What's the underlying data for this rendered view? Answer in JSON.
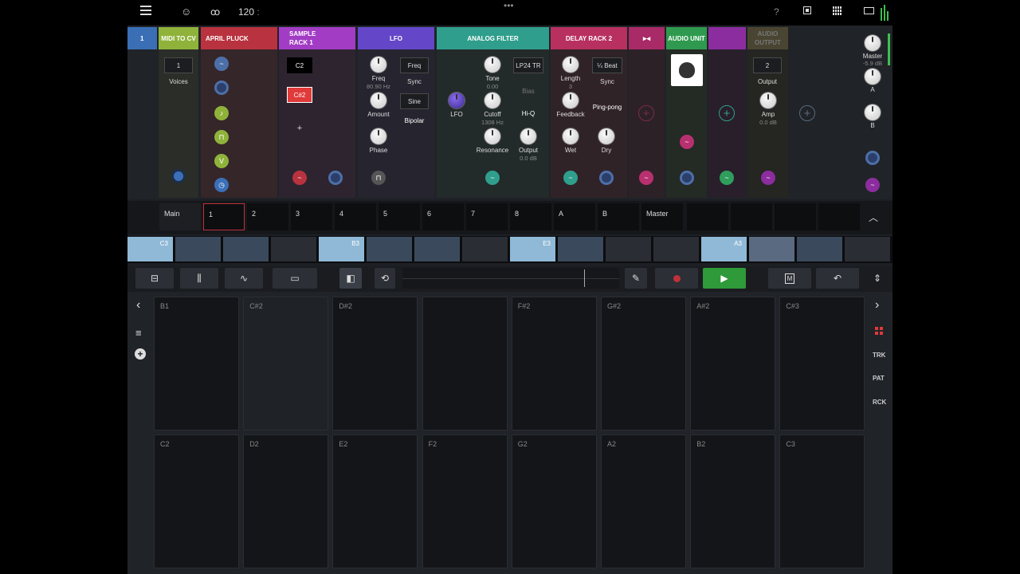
{
  "topbar": {
    "tempo": "120",
    "tempo_sep": ":"
  },
  "modules": {
    "track": {
      "label": "1",
      "color": "#3a6fb5"
    },
    "midi": {
      "title": "MIDI TO CV",
      "color": "#8fb33a",
      "value": "1",
      "value_label": "Voices"
    },
    "pluck": {
      "title": "APRIL PLUCK",
      "color": "#b8333f"
    },
    "sample": {
      "title_line1": "SAMPLE",
      "title_line2": "RACK 1",
      "color": "#a23cc4",
      "slot1": "C2",
      "slot2": "C#2",
      "add": "+"
    },
    "lfo": {
      "title": "LFO",
      "color": "#6447c8",
      "freq_label": "Freq",
      "freq_value": "80.90 Hz",
      "amount_label": "Amount",
      "phase_label": "Phase",
      "freq_box": "Freq",
      "sync_label": "Sync",
      "shape_box": "Sine",
      "bipolar_label": "Bipolar"
    },
    "filter": {
      "title": "ANALOG FILTER",
      "color": "#2f9e8c",
      "lfo_label": "LFO",
      "tone_label": "Tone",
      "tone_value": "0.00",
      "cutoff_label": "Cutoff",
      "cutoff_value": "1308 Hz",
      "resonance_label": "Resonance",
      "mode_box": "LP24 TR",
      "bias_label": "Bias",
      "hiq_label": "Hi-Q",
      "output_label": "Output",
      "output_value": "0.0 dB"
    },
    "delay": {
      "title": "DELAY RACK 2",
      "color": "#b83060",
      "length_label": "Length",
      "length_value": "3",
      "beat_box": "¼ Beat",
      "sync_label": "Sync",
      "feedback_label": "Feedback",
      "pingpong_label": "Ping-pong",
      "wet_label": "Wet",
      "dry_label": "Dry"
    },
    "arrow": {
      "title": "▸◂",
      "color": "#a82a66"
    },
    "audio_unit": {
      "title": "AUDIO UNIT",
      "color": "#2f9a4f"
    },
    "purple": {
      "color": "#8b2d9e"
    },
    "audio_out": {
      "title_line1": "AUDIO",
      "title_line2": "OUTPUT",
      "color": "#4a4532",
      "value": "2",
      "value_label": "Output",
      "amp_label": "Amp",
      "amp_value": "0.0 dB"
    },
    "master": {
      "label": "Master",
      "value": "-5.9 dB",
      "a_label": "A",
      "b_label": "B"
    }
  },
  "tabs": [
    "Main",
    "1",
    "2",
    "3",
    "4",
    "5",
    "6",
    "7",
    "8",
    "A",
    "B",
    "Master"
  ],
  "clips": [
    {
      "label": "C3",
      "color": "#8fb9d6"
    },
    {
      "label": "",
      "color": "#3a4a5c"
    },
    {
      "label": "",
      "color": "#3a4a5c"
    },
    {
      "label": "",
      "color": "#2a2d33"
    },
    {
      "label": "B3",
      "color": "#8fb9d6"
    },
    {
      "label": "",
      "color": "#3a4a5c"
    },
    {
      "label": "",
      "color": "#3a4a5c"
    },
    {
      "label": "",
      "color": "#2a2d33"
    },
    {
      "label": "E3",
      "color": "#8fb9d6"
    },
    {
      "label": "",
      "color": "#3a4a5c"
    },
    {
      "label": "",
      "color": "#2a2d33"
    },
    {
      "label": "",
      "color": "#2a2d33"
    },
    {
      "label": "A3",
      "color": "#8fb9d6"
    },
    {
      "label": "",
      "color": "#5a6a80"
    },
    {
      "label": "",
      "color": "#3a4a5c"
    },
    {
      "label": "",
      "color": "#2a2d33"
    }
  ],
  "toolbar": {
    "m_label": "M"
  },
  "pads_top": [
    "B1",
    "C#2",
    "D#2",
    "",
    "F#2",
    "G#2",
    "A#2",
    "C#3"
  ],
  "pads_bottom": [
    "C2",
    "D2",
    "E2",
    "F2",
    "G2",
    "A2",
    "B2",
    "C3"
  ],
  "side_right": {
    "trk": "TRK",
    "pat": "PAT",
    "rck": "RCK"
  },
  "accent": {
    "play": "#2f9a3a",
    "record": "#c0303a"
  }
}
